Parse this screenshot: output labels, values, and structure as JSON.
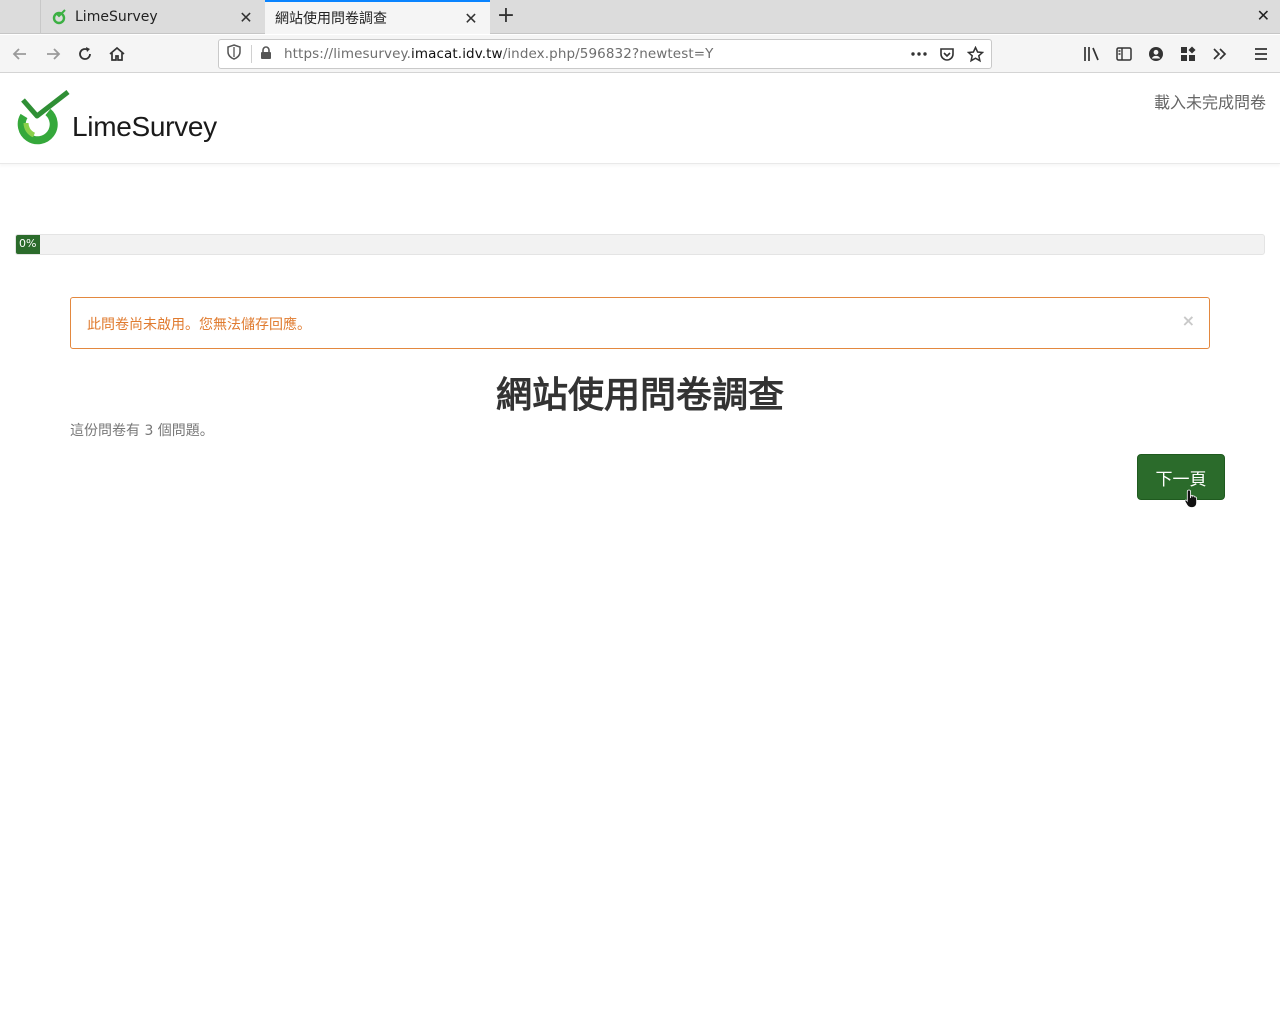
{
  "browser": {
    "tabs": [
      {
        "title": "LimeSurvey",
        "active": false
      },
      {
        "title": "網站使用問卷調查",
        "active": true
      }
    ],
    "url": {
      "prefix": "https://limesurvey.",
      "domain": "imacat.idv.tw",
      "path": "/index.php/596832?newtest=Y"
    },
    "accent_color": "#0a84ff"
  },
  "header": {
    "logo_text": "LimeSurvey",
    "load_unfinished_label": "載入未完成問卷"
  },
  "progress": {
    "value": 0,
    "label": "0%"
  },
  "alert": {
    "message": "此問卷尚未啟用。您無法儲存回應。",
    "close_symbol": "×",
    "color": "#e07b2f"
  },
  "survey": {
    "title": "網站使用問卷調查",
    "description": "這份問卷有 3 個問題。",
    "next_button_label": "下一頁",
    "brand_color": "#2b6b2b"
  }
}
